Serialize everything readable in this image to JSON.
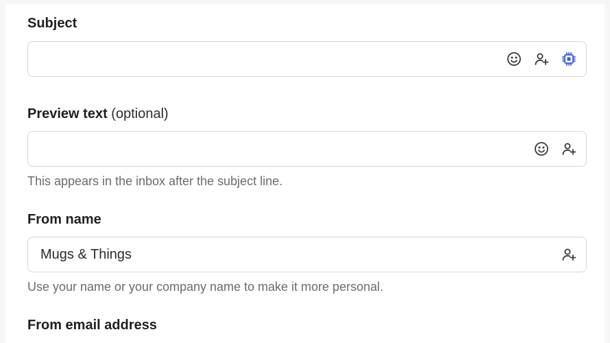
{
  "fields": {
    "subject": {
      "label": "Subject",
      "value": "",
      "icons": [
        "emoji-icon",
        "personalize-icon",
        "ai-chip-icon"
      ]
    },
    "preview": {
      "label": "Preview text",
      "optional": "(optional)",
      "value": "",
      "help": "This appears in the inbox after the subject line.",
      "icons": [
        "emoji-icon",
        "personalize-icon"
      ]
    },
    "from_name": {
      "label": "From name",
      "value": "Mugs & Things",
      "help": "Use your name or your company name to make it more personal.",
      "icons": [
        "personalize-icon"
      ]
    },
    "from_email": {
      "label": "From email address"
    }
  },
  "colors": {
    "accent_ai": "#3b5bdb",
    "icon": "#3a3a3a",
    "border": "#d4d4d4",
    "help_text": "#6b6b6b"
  }
}
